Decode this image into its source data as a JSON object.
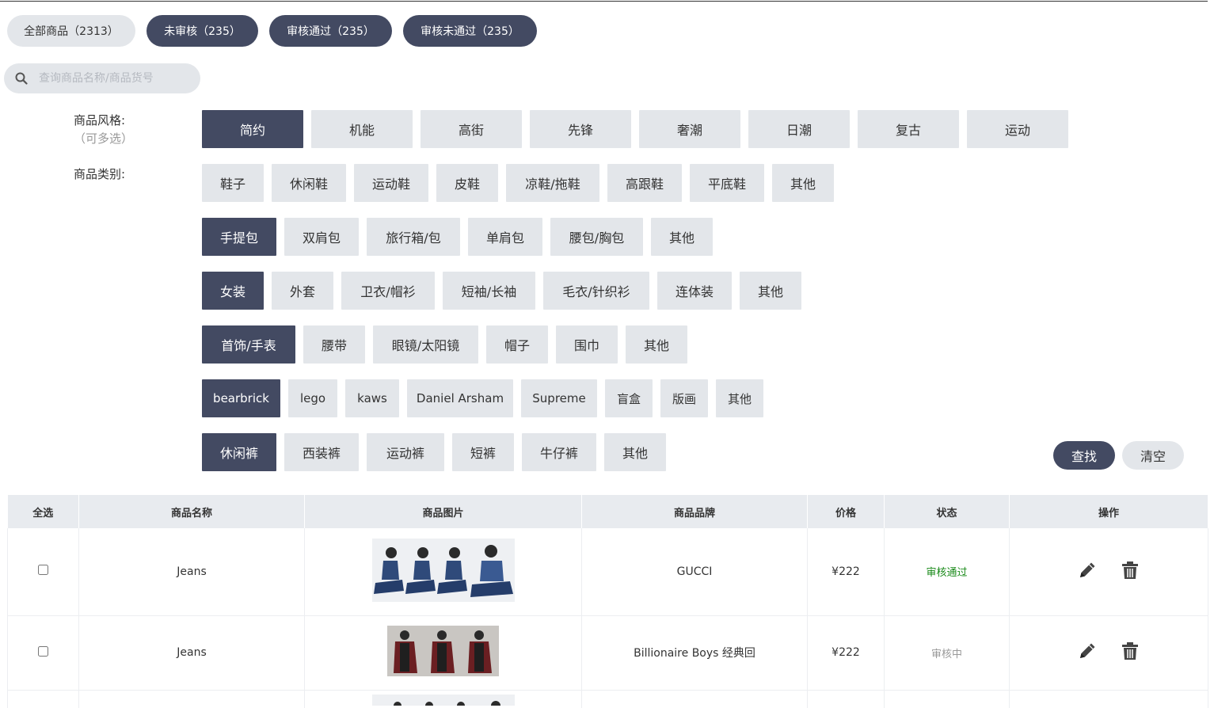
{
  "tabs": [
    {
      "label": "全部商品（2313）",
      "active": false
    },
    {
      "label": "未审核（235）",
      "active": true
    },
    {
      "label": "审核通过（235）",
      "active": true
    },
    {
      "label": "审核未通过（235）",
      "active": true
    }
  ],
  "search": {
    "placeholder": "查询商品名称/商品货号"
  },
  "style_filter": {
    "label": "商品风格:",
    "sub_label": "（可多选）",
    "options": [
      "简约",
      "机能",
      "高街",
      "先锋",
      "奢潮",
      "日潮",
      "复古",
      "运动"
    ],
    "selected": "简约"
  },
  "category_filter": {
    "label": "商品类别:",
    "rows": [
      {
        "options": [
          "鞋子",
          "休闲鞋",
          "运动鞋",
          "皮鞋",
          "凉鞋/拖鞋",
          "高跟鞋",
          "平底鞋",
          "其他"
        ],
        "selected": null
      },
      {
        "options": [
          "手提包",
          "双肩包",
          "旅行箱/包",
          "单肩包",
          "腰包/胸包",
          "其他"
        ],
        "selected": "手提包"
      },
      {
        "options": [
          "女装",
          "外套",
          "卫衣/帽衫",
          "短袖/长袖",
          "毛衣/针织衫",
          "连体装",
          "其他"
        ],
        "selected": "女装"
      },
      {
        "options": [
          "首饰/手表",
          "腰带",
          "眼镜/太阳镜",
          "帽子",
          "围巾",
          "其他"
        ],
        "selected": "首饰/手表"
      },
      {
        "options": [
          "bearbrick",
          "lego",
          "kaws",
          "Daniel Arsham",
          "Supreme",
          "盲盒",
          "版画",
          "其他"
        ],
        "selected": "bearbrick"
      },
      {
        "options": [
          "休闲裤",
          "西装裤",
          "运动裤",
          "短裤",
          "牛仔裤",
          "其他"
        ],
        "selected": "休闲裤"
      }
    ]
  },
  "buttons": {
    "find": "查找",
    "clear": "清空"
  },
  "table": {
    "headers": [
      "全选",
      "商品名称",
      "商品图片",
      "商品品牌",
      "价格",
      "状态",
      "操作"
    ],
    "rows": [
      {
        "name": "Jeans",
        "brand": "GUCCI",
        "price": "¥222",
        "status": "审核通过",
        "status_color": "#1a8a1a"
      },
      {
        "name": "Jeans",
        "brand": "Billionaire Boys 经典回",
        "price": "¥222",
        "status": "审核中",
        "status_color": "#999999"
      }
    ]
  },
  "icons": {
    "search": "search-icon",
    "edit": "pencil-icon",
    "delete": "trash-icon"
  },
  "colors": {
    "accent": "#434a62",
    "chip_bg": "#e3e6ea",
    "header_bg": "#e8ebef"
  }
}
